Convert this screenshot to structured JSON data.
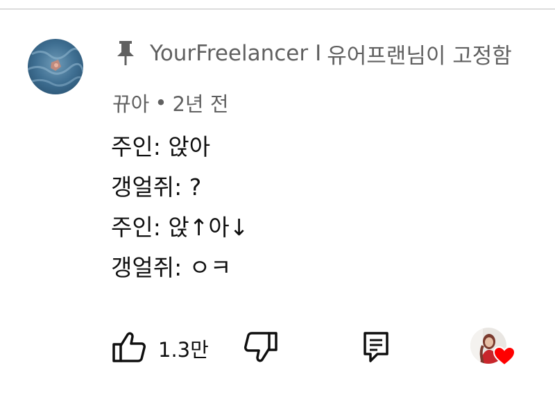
{
  "pinned": {
    "icon": "pin-icon",
    "channel_name": "YourFreelancer",
    "separator": "I",
    "pinned_by_text": "유어프랜님이 고정함"
  },
  "comment": {
    "author": "뀨아",
    "dot": "•",
    "time_ago": "2년 전",
    "lines": [
      "주인: 앉아",
      "갱얼쥐: ?",
      "주인: 앉↑아↓",
      "갱얼쥐: ㅇㅋ"
    ]
  },
  "actions": {
    "like_icon": "thumbs-up-icon",
    "like_count": "1.3만",
    "dislike_icon": "thumbs-down-icon",
    "reply_icon": "reply-comment-icon",
    "creator_heart_icon": "heart-icon",
    "heart_color": "#ff0000"
  },
  "colors": {
    "secondary_text": "#606060",
    "primary_text": "#0f0f0f"
  }
}
